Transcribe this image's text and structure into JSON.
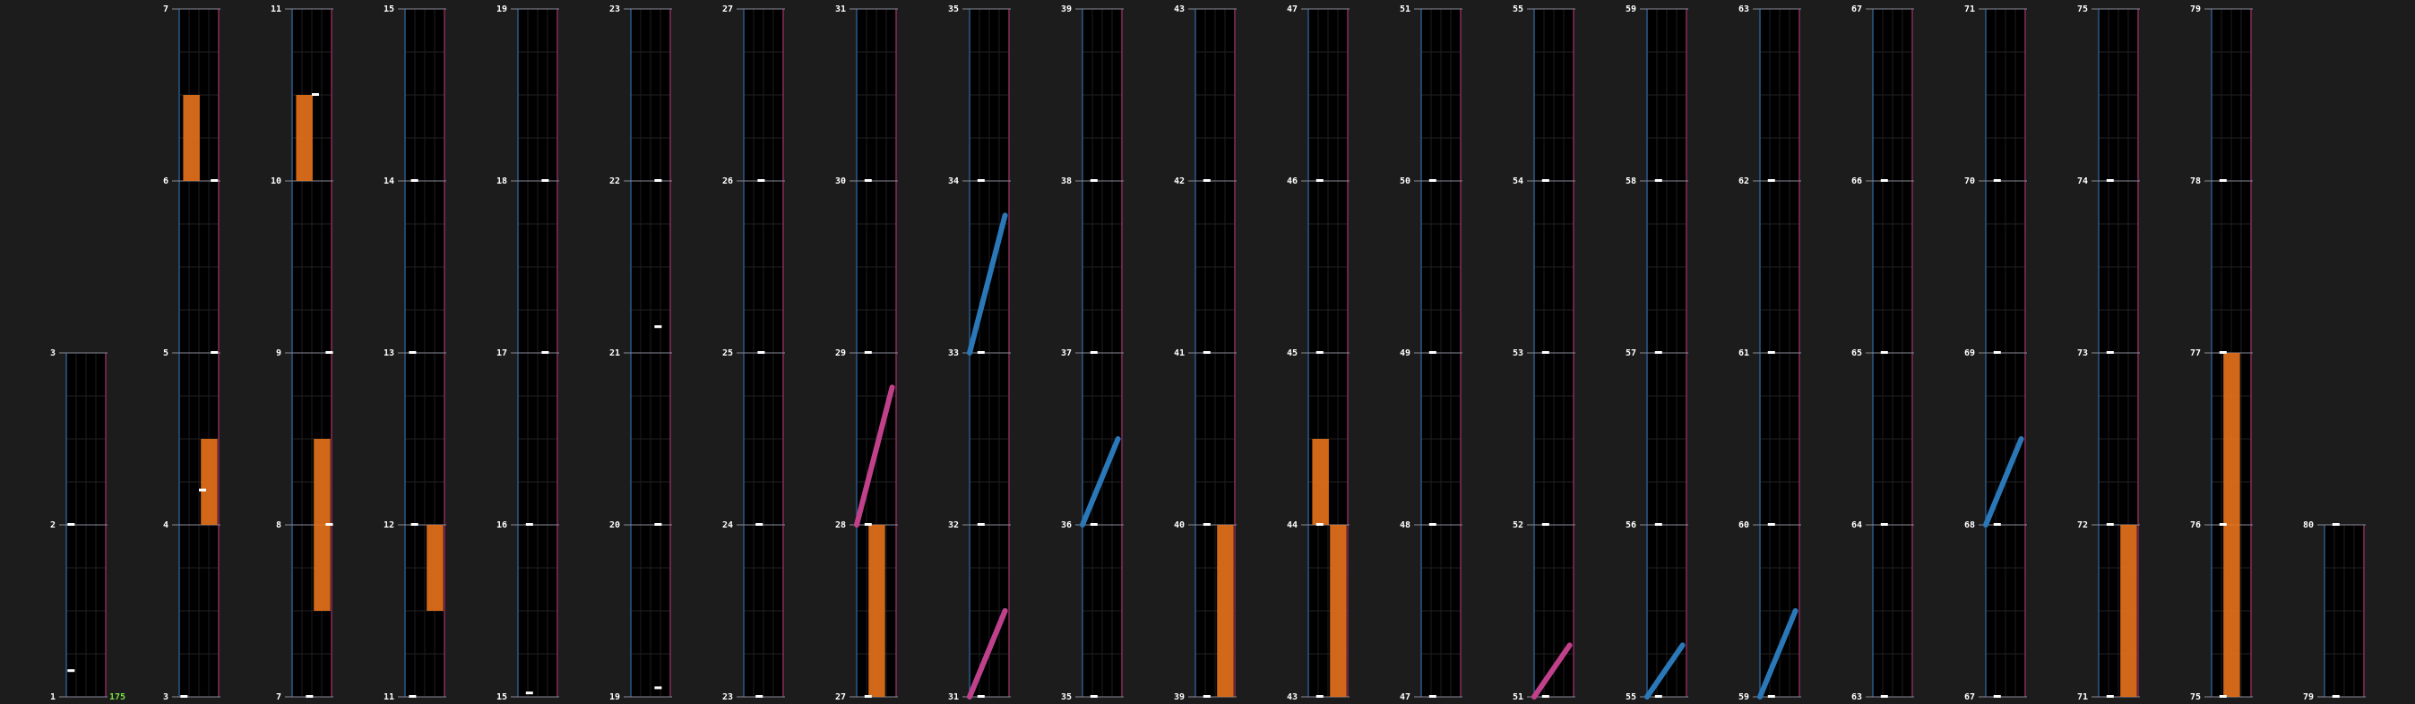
{
  "app": {
    "view": "chart-editor-preview",
    "bpm_label": "175"
  },
  "colors": {
    "background": "#1c1c1c",
    "lane_bg": "#000000",
    "lane_border_left": "#2a5a8a",
    "lane_border_right": "#8a2a5a",
    "beat_line": "#8a8a9a",
    "hold": "#e8721c",
    "slide_left": "#2a78b8",
    "slide_right": "#c0408a",
    "tap": "#ffffff",
    "label": "#ffffff",
    "bpm": "#7be03c"
  },
  "measure_count": 80,
  "notes": {
    "taps": [
      [
        1,
        0.03,
        0.15
      ],
      [
        2,
        0.03,
        0.0
      ],
      [
        3,
        0.03,
        0.0
      ],
      [
        4,
        0.5,
        0.2
      ],
      [
        5,
        0.8,
        0.0
      ],
      [
        6,
        0.8,
        0.0
      ],
      [
        7,
        0.35,
        0.0
      ],
      [
        8,
        0.85,
        0.0
      ],
      [
        9,
        0.85,
        0.0
      ],
      [
        10,
        0.5,
        0.5
      ],
      [
        11,
        0.1,
        0.0
      ],
      [
        12,
        0.15,
        0.0
      ],
      [
        13,
        0.1,
        0.0
      ],
      [
        14,
        0.15,
        0.0
      ],
      [
        15,
        0.2,
        0.02
      ],
      [
        16,
        0.2,
        0.0
      ],
      [
        17,
        0.6,
        0.0
      ],
      [
        18,
        0.6,
        0.0
      ],
      [
        19,
        0.6,
        0.05
      ],
      [
        20,
        0.6,
        0.0
      ],
      [
        21,
        0.6,
        0.15
      ],
      [
        22,
        0.6,
        0.0
      ],
      [
        23,
        0.3,
        0.0
      ],
      [
        24,
        0.3,
        0.0
      ],
      [
        25,
        0.35,
        0.0
      ],
      [
        26,
        0.35,
        0.0
      ],
      [
        27,
        0.2,
        0.0
      ],
      [
        28,
        0.2,
        0.0
      ],
      [
        29,
        0.2,
        0.0
      ],
      [
        30,
        0.2,
        0.0
      ],
      [
        31,
        0.2,
        0.0
      ],
      [
        32,
        0.2,
        0.0
      ],
      [
        33,
        0.2,
        0.0
      ],
      [
        34,
        0.2,
        0.0
      ],
      [
        35,
        0.2,
        0.0
      ],
      [
        36,
        0.2,
        0.0
      ],
      [
        37,
        0.2,
        0.0
      ],
      [
        38,
        0.2,
        0.0
      ],
      [
        39,
        0.2,
        0.0
      ],
      [
        40,
        0.2,
        0.0
      ],
      [
        41,
        0.2,
        0.0
      ],
      [
        42,
        0.2,
        0.0
      ],
      [
        43,
        0.2,
        0.0
      ],
      [
        44,
        0.2,
        0.0
      ],
      [
        45,
        0.2,
        0.0
      ],
      [
        46,
        0.2,
        0.0
      ],
      [
        47,
        0.2,
        0.0
      ],
      [
        48,
        0.2,
        0.0
      ],
      [
        49,
        0.2,
        0.0
      ],
      [
        50,
        0.2,
        0.0
      ],
      [
        51,
        0.2,
        0.0
      ],
      [
        52,
        0.2,
        0.0
      ],
      [
        53,
        0.2,
        0.0
      ],
      [
        54,
        0.2,
        0.0
      ],
      [
        55,
        0.2,
        0.0
      ],
      [
        56,
        0.2,
        0.0
      ],
      [
        57,
        0.2,
        0.0
      ],
      [
        58,
        0.2,
        0.0
      ],
      [
        59,
        0.2,
        0.0
      ],
      [
        60,
        0.2,
        0.0
      ],
      [
        61,
        0.2,
        0.0
      ],
      [
        62,
        0.2,
        0.0
      ],
      [
        63,
        0.2,
        0.0
      ],
      [
        64,
        0.2,
        0.0
      ],
      [
        65,
        0.2,
        0.0
      ],
      [
        66,
        0.2,
        0.0
      ],
      [
        67,
        0.2,
        0.0
      ],
      [
        68,
        0.2,
        0.0
      ],
      [
        69,
        0.2,
        0.0
      ],
      [
        70,
        0.2,
        0.0
      ],
      [
        71,
        0.2,
        0.0
      ],
      [
        72,
        0.2,
        0.0
      ],
      [
        73,
        0.2,
        0.0
      ],
      [
        74,
        0.2,
        0.0
      ],
      [
        75,
        0.2,
        0.0
      ],
      [
        76,
        0.2,
        0.0
      ],
      [
        77,
        0.2,
        0.0
      ],
      [
        78,
        0.2,
        0.0
      ],
      [
        79,
        0.2,
        0.0
      ],
      [
        80,
        0.2,
        0.0
      ]
    ],
    "holds": [
      [
        4,
        0.55,
        0.0,
        0.5
      ],
      [
        6,
        0.1,
        0.0,
        0.5
      ],
      [
        7,
        0.55,
        0.5,
        1.0
      ],
      [
        8,
        0.55,
        0.0,
        0.5
      ],
      [
        10,
        0.1,
        0.0,
        0.5
      ],
      [
        11,
        0.55,
        0.5,
        1.0
      ],
      [
        27,
        0.3,
        0.0,
        1.0
      ],
      [
        39,
        0.55,
        0.0,
        1.0
      ],
      [
        43,
        0.55,
        0.0,
        1.0
      ],
      [
        44,
        0.1,
        0.0,
        0.5
      ],
      [
        71,
        0.55,
        0.0,
        1.0
      ],
      [
        75,
        0.3,
        0.0,
        1.0
      ],
      [
        76,
        0.3,
        0.0,
        1.0
      ]
    ],
    "slides_left": [
      [
        31,
        0.0,
        0.5
      ],
      [
        33,
        0.0,
        0.8
      ],
      [
        36,
        0.0,
        0.5
      ],
      [
        55,
        0.0,
        0.3
      ],
      [
        59,
        0.0,
        0.5
      ],
      [
        68,
        0.0,
        0.5
      ]
    ],
    "slides_right": [
      [
        28,
        0.0,
        0.8
      ],
      [
        31,
        0.0,
        0.5
      ],
      [
        51,
        0.0,
        0.3
      ]
    ]
  },
  "columns": [
    {
      "col": 0,
      "labels": [
        "1",
        "2",
        "3"
      ]
    },
    {
      "col": 1,
      "labels": [
        "3",
        "4",
        "5",
        "6",
        "7"
      ]
    },
    {
      "col": 2,
      "labels": [
        "7",
        "8",
        "9",
        "10",
        "11"
      ]
    },
    {
      "col": 3,
      "labels": [
        "11",
        "12",
        "13",
        "14",
        "15"
      ]
    },
    {
      "col": 4,
      "labels": [
        "15",
        "16",
        "17",
        "18",
        "19"
      ]
    },
    {
      "col": 5,
      "labels": [
        "19",
        "20",
        "21",
        "22",
        "23"
      ]
    },
    {
      "col": 6,
      "labels": [
        "23",
        "24",
        "25",
        "26",
        "27"
      ]
    },
    {
      "col": 7,
      "labels": [
        "27",
        "28",
        "29",
        "30",
        "31"
      ]
    },
    {
      "col": 8,
      "labels": [
        "31",
        "32",
        "33",
        "34",
        "35"
      ]
    },
    {
      "col": 9,
      "labels": [
        "35",
        "36",
        "37",
        "38",
        "39"
      ]
    },
    {
      "col": 10,
      "labels": [
        "39",
        "40",
        "41",
        "42",
        "43"
      ]
    },
    {
      "col": 11,
      "labels": [
        "43",
        "44",
        "45",
        "46",
        "47"
      ]
    },
    {
      "col": 12,
      "labels": [
        "47",
        "48",
        "49",
        "50",
        "51"
      ]
    },
    {
      "col": 13,
      "labels": [
        "51",
        "52",
        "53",
        "54",
        "55"
      ]
    },
    {
      "col": 14,
      "labels": [
        "55",
        "56",
        "57",
        "58",
        "59"
      ]
    },
    {
      "col": 15,
      "labels": [
        "59",
        "60",
        "61",
        "62",
        "63"
      ]
    },
    {
      "col": 16,
      "labels": [
        "63",
        "64",
        "65",
        "66",
        "67"
      ]
    },
    {
      "col": 17,
      "labels": [
        "67",
        "68",
        "69",
        "70",
        "71"
      ]
    },
    {
      "col": 18,
      "labels": [
        "71",
        "72",
        "73",
        "74",
        "75"
      ]
    },
    {
      "col": 19,
      "labels": [
        "75",
        "76",
        "77",
        "78",
        "79"
      ]
    },
    {
      "col": 20,
      "labels": [
        "79",
        "80"
      ]
    }
  ]
}
